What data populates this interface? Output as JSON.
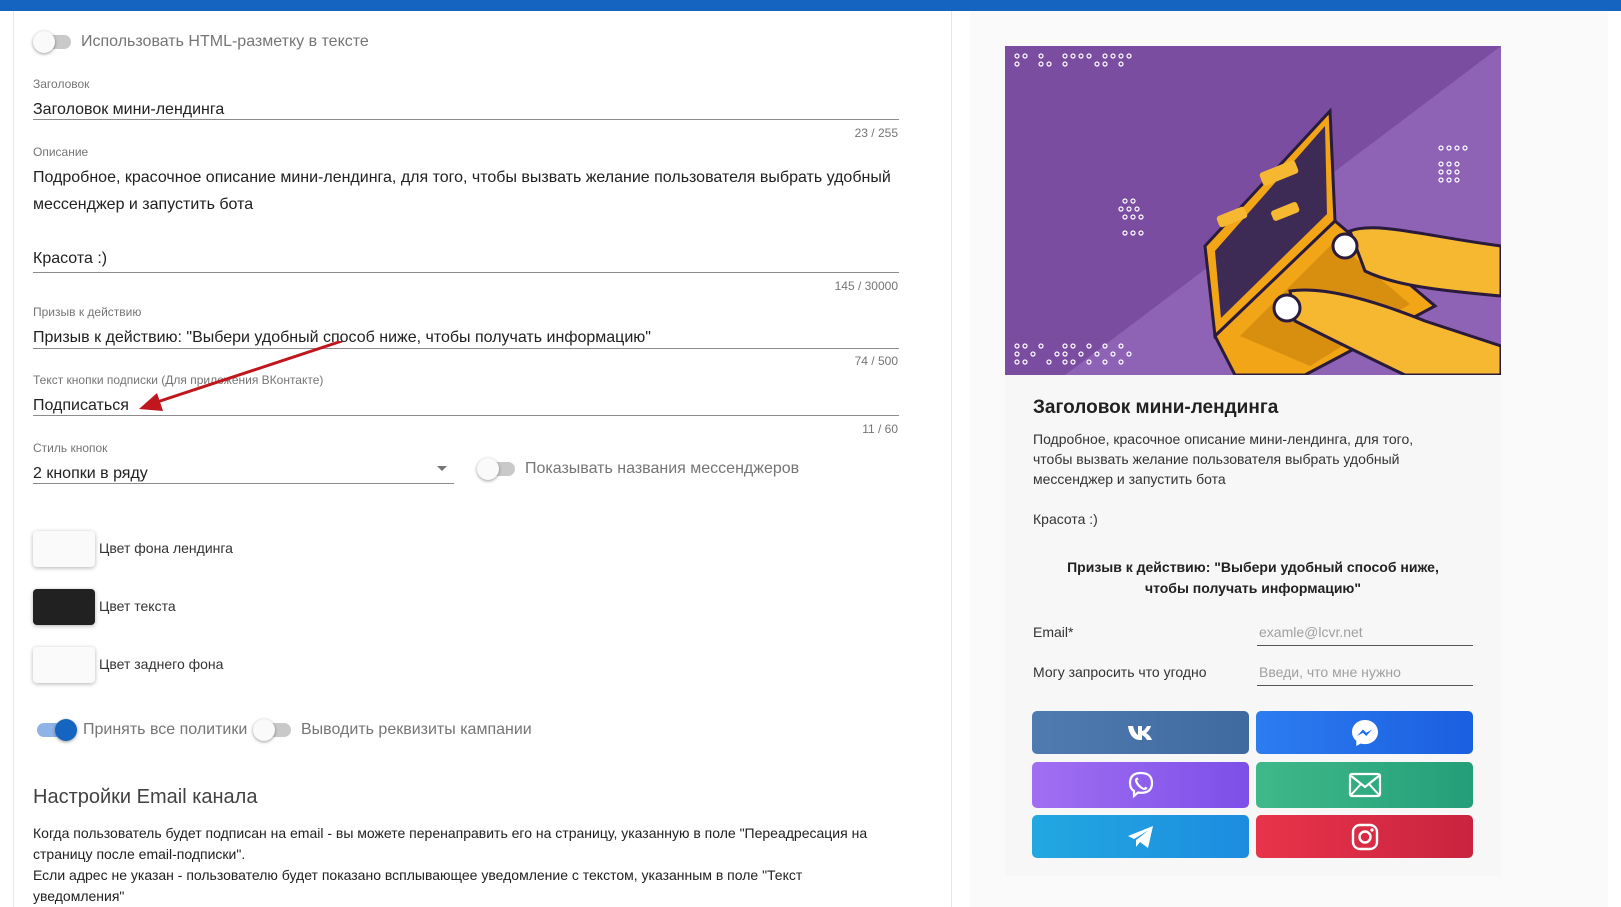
{
  "form": {
    "html_toggle": {
      "label": "Использовать HTML-разметку в тексте",
      "on": false
    },
    "title_field": {
      "label": "Заголовок",
      "value": "Заголовок мини-лендинга",
      "counter": "23 / 255"
    },
    "description_field": {
      "label": "Описание",
      "lines": [
        "Подробное, красочное описание мини-лендинга, для того, чтобы вызвать желание пользователя выбрать удобный",
        "мессенджер и запустить бота",
        "",
        "Красота :)"
      ],
      "counter": "145 / 30000"
    },
    "cta_field": {
      "label": "Призыв к действию",
      "value": "Призыв к действию: \"Выбери удобный способ ниже, чтобы получать информацию\"",
      "counter": "74 / 500"
    },
    "subscribe_field": {
      "label": "Текст кнопки подписки (Для приложения ВКонтакте)",
      "value": "Подписаться",
      "counter": "11 / 60"
    },
    "button_style": {
      "label": "Стиль кнопок",
      "value": "2 кнопки в ряду"
    },
    "show_names_toggle": {
      "label": "Показывать названия мессенджеров",
      "on": false
    },
    "colors": [
      {
        "label": "Цвет фона лендинга",
        "color": "#fafafa"
      },
      {
        "label": "Цвет текста",
        "color": "#212121"
      },
      {
        "label": "Цвет заднего фона",
        "color": "#fafafa"
      }
    ],
    "accept_policies_toggle": {
      "label": "Принять все политики",
      "on": true
    },
    "show_requisites_toggle": {
      "label": "Выводить реквизиты кампании",
      "on": false
    },
    "email_section": {
      "title": "Настройки Email канала",
      "text_1": "Когда пользователь будет подписан на email - вы можете перенаправить его на страницу, указанную в поле \"Переадресация на страницу после email-подписки\".",
      "text_2": "Если адрес не указан - пользователю будет показано всплывающее уведомление с текстом, указанным в поле \"Текст уведомления\""
    }
  },
  "preview": {
    "title": "Заголовок мини-лендинга",
    "description": "Подробное, красочное описание мини-лендинга, для того, чтобы вызвать желание пользователя выбрать удобный мессенджер и запустить бота",
    "beauty": "Красота :)",
    "cta": "Призыв к действию: \"Выбери удобный способ ниже, чтобы получать информацию\"",
    "email_label": "Email*",
    "email_placeholder": "examle@lcvr.net",
    "request_label": "Могу запросить что угодно",
    "request_placeholder": "Введи, что мне нужно",
    "messengers": [
      {
        "name": "vk",
        "icon": "vk-icon",
        "color": "#4a76a8"
      },
      {
        "name": "messenger",
        "icon": "messenger-icon",
        "color": "#1a6bf0"
      },
      {
        "name": "viber",
        "icon": "viber-icon",
        "color": "#8a5cf0"
      },
      {
        "name": "email",
        "icon": "email-icon",
        "color": "#2fae7d"
      },
      {
        "name": "telegram",
        "icon": "telegram-icon",
        "color": "#1f96e0"
      },
      {
        "name": "instagram",
        "icon": "instagram-icon",
        "color": "#e63b55"
      }
    ]
  }
}
